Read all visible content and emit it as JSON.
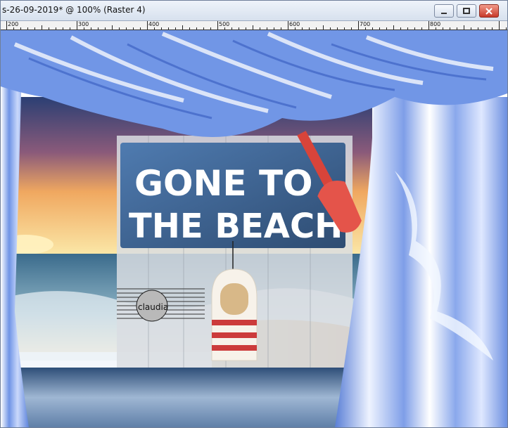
{
  "window": {
    "title": "s-26-09-2019* @ 100% (Raster 4)"
  },
  "controls": {
    "minimize_icon": "minimize-icon",
    "maximize_icon": "maximize-icon",
    "close_icon": "close-icon"
  },
  "ruler": {
    "labels": [
      "200",
      "300",
      "400",
      "500",
      "600",
      "700",
      "800"
    ]
  },
  "artwork": {
    "sign_line1": "GONE TO",
    "sign_line2": "THE BEACH",
    "watermark": "claudia"
  },
  "colors": {
    "close_button": "#d64533",
    "curtain": "#6f94e6",
    "sign": "#35577f"
  }
}
